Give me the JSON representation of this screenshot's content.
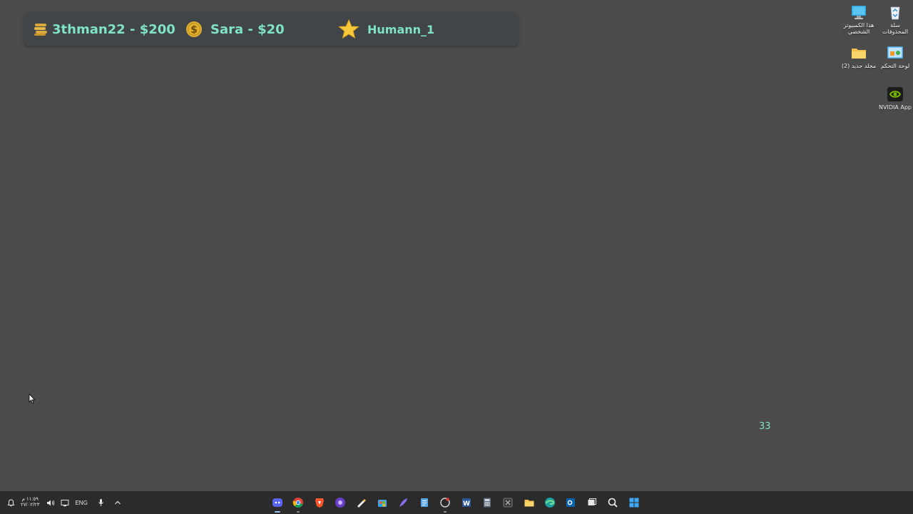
{
  "overlay": {
    "items": [
      {
        "icon": "coins-icon",
        "text": "3thman22 - $200"
      },
      {
        "icon": "dollar-coin-icon",
        "text": "Sara - $20"
      },
      {
        "icon": "star-icon",
        "text": "Humann_1"
      }
    ],
    "accent_color": "#7fe3c8"
  },
  "desktop_icons": [
    {
      "icon": "computer-icon",
      "label": "هذا الكمبيوتر الشخصي"
    },
    {
      "icon": "recycle-bin-icon",
      "label": "سلة المحذوفات"
    },
    {
      "icon": "folder-icon",
      "label": "مجلد جديد (2)"
    },
    {
      "icon": "control-panel-icon",
      "label": "لوحة التحكم"
    },
    {
      "icon": "nvidia-icon",
      "label": "NVIDIA App"
    }
  ],
  "counter": "33",
  "taskbar": {
    "time": "١١:٥٩ م",
    "date": "٢٧/٠٢/٢٣",
    "language": "ENG",
    "apps": [
      "discord-icon",
      "chrome-icon",
      "brave-icon",
      "app-icon",
      "pen-tool-icon",
      "store-icon",
      "feather-icon",
      "notepad-icon",
      "screenshot-icon",
      "word-icon",
      "calculator-icon",
      "excel-icon",
      "file-explorer-icon",
      "edge-icon",
      "outlook-icon",
      "task-view-icon",
      "search-icon",
      "start-icon"
    ]
  }
}
